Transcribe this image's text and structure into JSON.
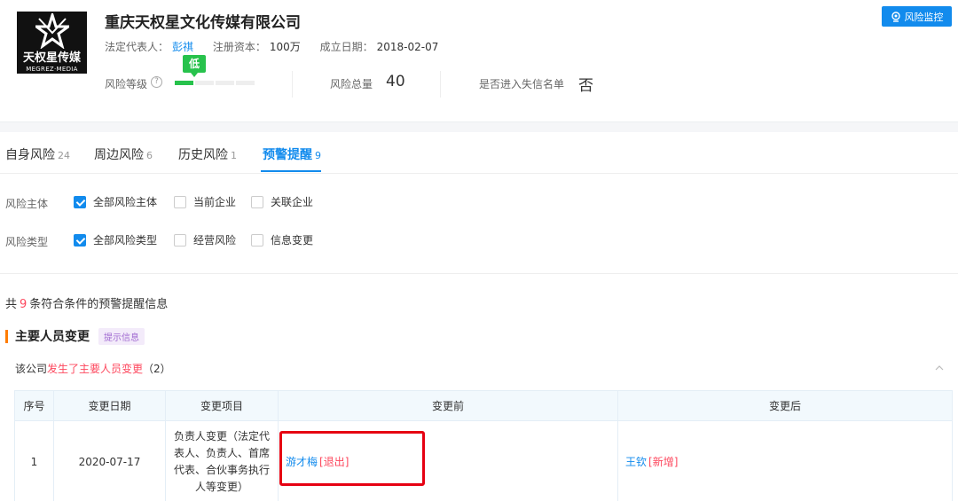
{
  "company": {
    "logo_cn": "天权星传媒",
    "logo_en": "MEGREZ·MEDIA",
    "name": "重庆天权星文化传媒有限公司",
    "legal_rep_label": "法定代表人：",
    "legal_rep": "彭祺",
    "capital_label": "注册资本：",
    "capital": "100万",
    "founded_label": "成立日期：",
    "founded": "2018-02-07"
  },
  "monitor_button": "风险监控",
  "risk": {
    "level_label": "风险等级",
    "help_icon": "?",
    "level_badge": "低",
    "level_fraction": 0.25,
    "total_label": "风险总量",
    "total": "40",
    "blacklist_label": "是否进入失信名单",
    "blacklist": "否"
  },
  "tabs": [
    {
      "label": "自身风险",
      "count": "24"
    },
    {
      "label": "周边风险",
      "count": "6"
    },
    {
      "label": "历史风险",
      "count": "1"
    },
    {
      "label": "预警提醒",
      "count": "9",
      "active": true
    }
  ],
  "filters": {
    "subject": {
      "label": "风险主体",
      "options": [
        {
          "label": "全部风险主体",
          "checked": true
        },
        {
          "label": "当前企业",
          "checked": false
        },
        {
          "label": "关联企业",
          "checked": false
        }
      ]
    },
    "type": {
      "label": "风险类型",
      "options": [
        {
          "label": "全部风险类型",
          "checked": true
        },
        {
          "label": "经营风险",
          "checked": false
        },
        {
          "label": "信息变更",
          "checked": false
        }
      ]
    }
  },
  "summary": {
    "prefix": "共",
    "count": "9",
    "suffix": "条符合条件的预警提醒信息"
  },
  "section": {
    "title": "主要人员变更",
    "tag": "提示信息",
    "sub_prefix": "该公司",
    "sub_red": "发生了主要人员变更",
    "sub_count": "（2）"
  },
  "table": {
    "headers": [
      "序号",
      "变更日期",
      "变更项目",
      "变更前",
      "变更后"
    ],
    "rows": [
      {
        "index": "1",
        "date": "2020-07-17",
        "item": "负责人变更（法定代表人、负责人、首席代表、合伙事务执行人等变更）",
        "before_name": "游才梅",
        "before_tag": "[退出]",
        "after_name": "王钦",
        "after_tag": "[新增]"
      }
    ]
  },
  "colors": {
    "accent": "#128bed",
    "low_risk": "#27c24c",
    "highlight": "#fd485e",
    "annotation_box": "#e60012"
  }
}
